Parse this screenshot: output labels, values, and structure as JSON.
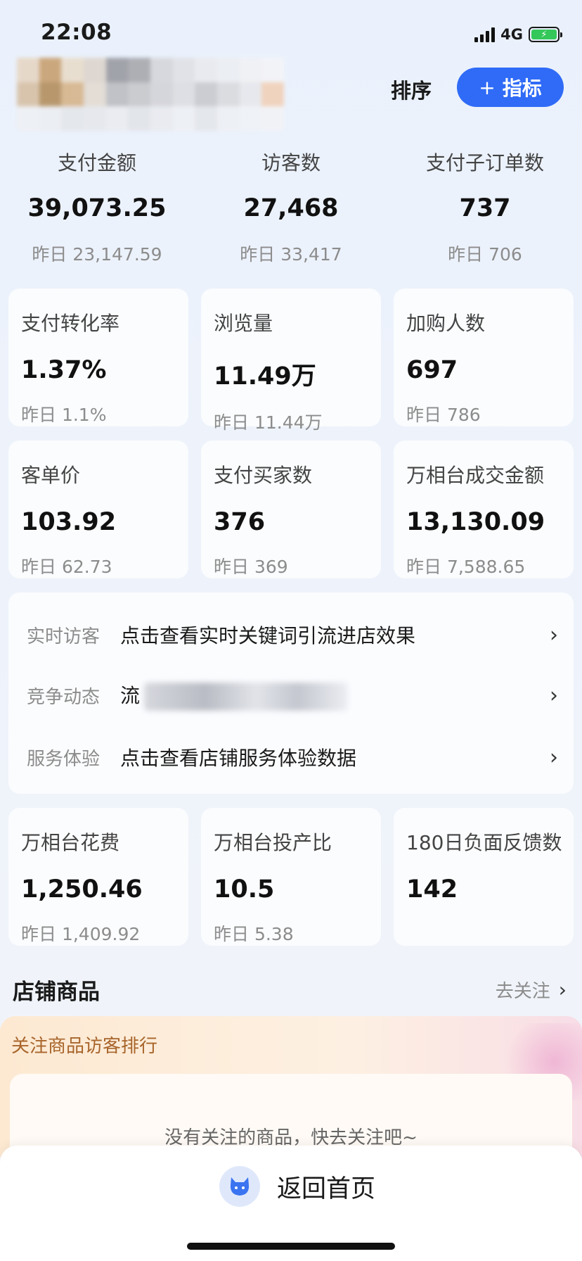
{
  "status_bar": {
    "time": "22:08",
    "network": "4G"
  },
  "header": {
    "sort_label": "排序",
    "metric_button_label": "指标",
    "plus_glyph": "+"
  },
  "top_metrics": [
    {
      "label": "支付金额",
      "value": "39,073.25",
      "yesterday": "昨日 23,147.59"
    },
    {
      "label": "访客数",
      "value": "27,468",
      "yesterday": "昨日 33,417"
    },
    {
      "label": "支付子订单数",
      "value": "737",
      "yesterday": "昨日 706"
    }
  ],
  "cards": [
    {
      "label": "支付转化率",
      "value": "1.37%",
      "yesterday": "昨日 1.1%"
    },
    {
      "label": "浏览量",
      "value": "11.49万",
      "yesterday": "昨日 11.44万"
    },
    {
      "label": "加购人数",
      "value": "697",
      "yesterday": "昨日 786"
    },
    {
      "label": "客单价",
      "value": "103.92",
      "yesterday": "昨日 62.73"
    },
    {
      "label": "支付买家数",
      "value": "376",
      "yesterday": "昨日 369"
    },
    {
      "label": "万相台成交金额",
      "value": "13,130.09",
      "yesterday": "昨日 7,588.65"
    }
  ],
  "info_rows": [
    {
      "label": "实时访客",
      "text": "点击查看实时关键词引流进店效果"
    },
    {
      "label": "竞争动态",
      "text": "流"
    },
    {
      "label": "服务体验",
      "text": "点击查看店铺服务体验数据"
    }
  ],
  "cards2": [
    {
      "label": "万相台花费",
      "value": "1,250.46",
      "yesterday": "昨日 1,409.92"
    },
    {
      "label": "万相台投产比",
      "value": "10.5",
      "yesterday": "昨日 5.38"
    },
    {
      "label": "180日负面反馈数",
      "value": "142",
      "yesterday": ""
    }
  ],
  "store_goods": {
    "title": "店铺商品",
    "follow_link": "去关注",
    "panel_title": "关注商品访客排行",
    "empty_text": "没有关注的商品，快去关注吧~"
  },
  "bottom": {
    "home_label": "返回首页"
  },
  "colors": {
    "accent": "#2f6bf6",
    "muted": "#8c8c8c",
    "panel_orange": "#a8652b"
  },
  "icons": [
    "chevron-right-icon",
    "plus-icon",
    "mascot-icon",
    "signal-icon",
    "battery-icon"
  ]
}
